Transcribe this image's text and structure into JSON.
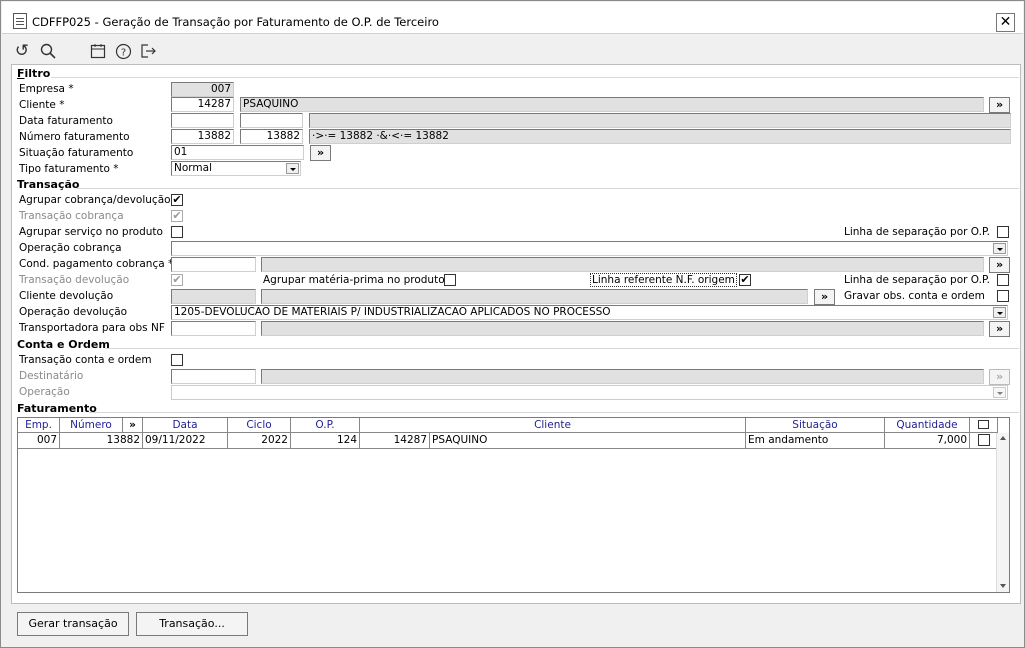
{
  "window": {
    "title": "CDFFP025 - Geração de Transação por Faturamento de O.P. de Terceiro",
    "close_label": "✕"
  },
  "toolbar": {
    "icons": [
      "undo-icon",
      "search-icon",
      "calendar-icon",
      "help-icon",
      "exit-icon"
    ]
  },
  "filtro": {
    "section": "Filtro",
    "empresa_label": "Empresa *",
    "empresa_value": "007",
    "cliente_label": "Cliente *",
    "cliente_code": "14287",
    "cliente_name": "PSAQUINO",
    "cliente_btn": "»",
    "data_label": "Data faturamento",
    "data_from": "",
    "data_to": "",
    "data_expr": "",
    "numero_label": "Número faturamento",
    "numero_from": "13882",
    "numero_to": "13882",
    "numero_expr": "·>·= 13882 ·&·<·= 13882",
    "situacao_label": "Situação faturamento",
    "situacao_value": "01",
    "situacao_btn": "»",
    "tipo_label": "Tipo faturamento *",
    "tipo_value": "Normal"
  },
  "transacao": {
    "section": "Transação",
    "agrupar_label": "Agrupar cobrança/devolução",
    "trans_cobranca_label": "Transação cobrança",
    "agrupar_servico_label": "Agrupar serviço no produto",
    "linha_sep_label": "Linha de separação por O.P.",
    "operacao_cobranca_label": "Operação cobrança",
    "operacao_cobranca_value": "",
    "cond_pag_label": "Cond. pagamento cobrança *",
    "cond_pag_value": "",
    "cond_pag_btn": "»",
    "trans_dev_label": "Transação devolução",
    "agrupar_mp_label": "Agrupar matéria-prima no produto",
    "linha_ref_label": "Linha referente N.F. origem",
    "linha_sep2_label": "Linha de separação por O.P.",
    "cliente_dev_label": "Cliente devolução",
    "cliente_dev_btn": "»",
    "gravar_obs_label": "Gravar obs. conta e ordem",
    "operacao_dev_label": "Operação devolução",
    "operacao_dev_value": "1205-DEVOLUCAO DE MATERIAIS P/ INDUSTRIALIZACAO APLICADOS NO PROCESSO",
    "transportadora_label": "Transportadora para obs NF",
    "transportadora_btn": "»"
  },
  "conta_ordem": {
    "section": "Conta e Ordem",
    "trans_label": "Transação conta e ordem",
    "destinatario_label": "Destinatário",
    "destinatario_btn": "»",
    "operacao_label": "Operação"
  },
  "faturamento": {
    "section": "Faturamento",
    "columns": [
      "Emp.",
      "Número",
      "»",
      "Data",
      "Ciclo",
      "O.P.",
      "Cliente",
      "Situação",
      "Quantidade"
    ],
    "rows": [
      {
        "emp": "007",
        "numero": "13882",
        "data": "09/11/2022",
        "ciclo": "2022",
        "op": "124",
        "cliente_code": "14287",
        "cliente_name": "PSAQUINO",
        "situacao": "Em andamento",
        "quantidade": "7,000"
      }
    ]
  },
  "buttons": {
    "gerar": "Gerar transação",
    "transacao": "Transação..."
  }
}
